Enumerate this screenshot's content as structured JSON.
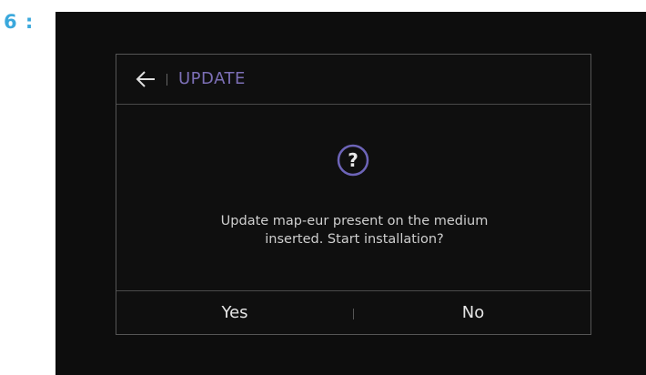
{
  "step": {
    "label": "6 :"
  },
  "dialog": {
    "title": "UPDATE",
    "icons": {
      "back": "back-arrow-icon",
      "question": "question-icon"
    },
    "message_line1": "Update map-eur present on the medium",
    "message_line2": "inserted. Start installation?",
    "buttons": {
      "yes": "Yes",
      "no": "No"
    }
  },
  "colors": {
    "step_label": "#3aa8dc",
    "title": "#7c6fb6",
    "question_icon": "#6d64b8",
    "background": "#0d0d0d"
  }
}
